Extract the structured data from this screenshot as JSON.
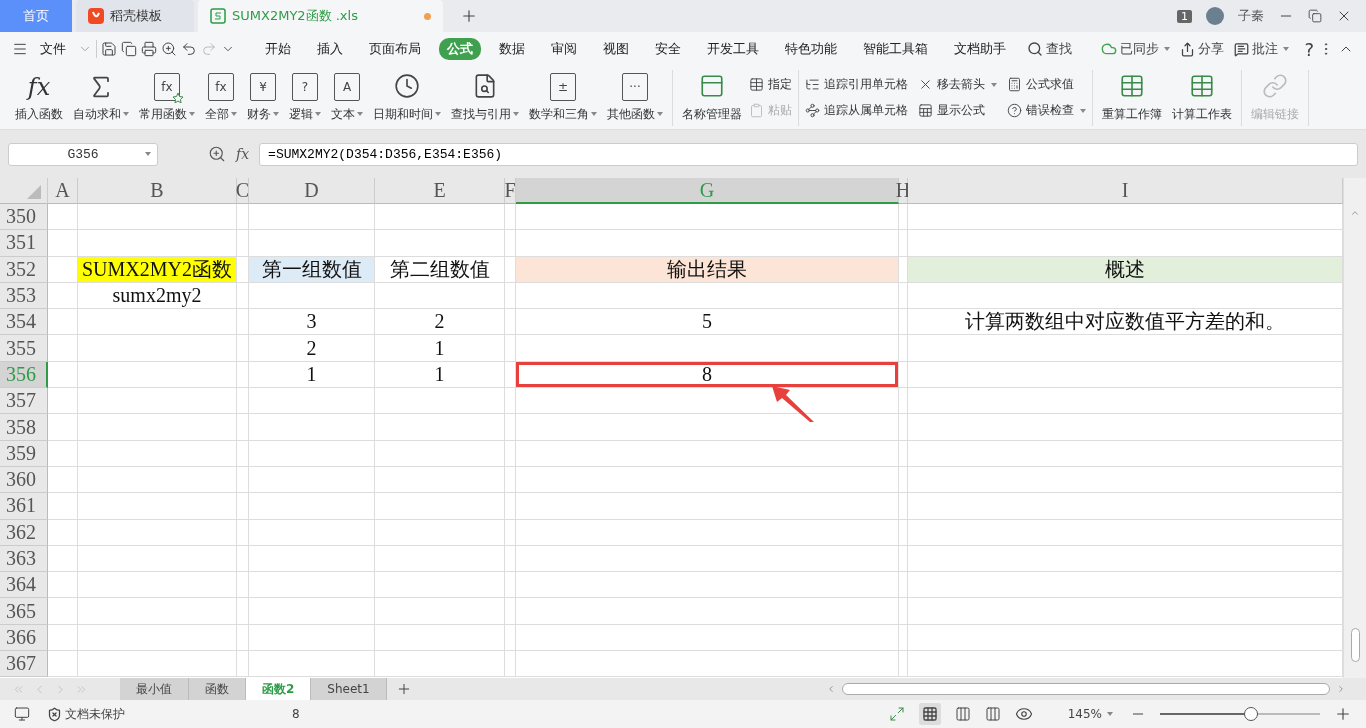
{
  "tabs": [
    {
      "label": "首页",
      "kind": "home",
      "selected": false,
      "modified": false
    },
    {
      "label": "稻壳模板",
      "kind": "docer",
      "selected": false,
      "modified": false
    },
    {
      "label": "SUMX2MY2函数 .xls",
      "kind": "sheet",
      "selected": true,
      "modified": true
    }
  ],
  "window_badge": "1",
  "user": "子秦",
  "menu": {
    "file": "文件",
    "tabs": [
      {
        "label": "开始",
        "selected": false
      },
      {
        "label": "插入",
        "selected": false
      },
      {
        "label": "页面布局",
        "selected": false
      },
      {
        "label": "公式",
        "selected": true
      },
      {
        "label": "数据",
        "selected": false
      },
      {
        "label": "审阅",
        "selected": false
      },
      {
        "label": "视图",
        "selected": false
      },
      {
        "label": "安全",
        "selected": false
      },
      {
        "label": "开发工具",
        "selected": false
      },
      {
        "label": "特色功能",
        "selected": false
      },
      {
        "label": "智能工具箱",
        "selected": false
      },
      {
        "label": "文档助手",
        "selected": false
      }
    ],
    "search": "查找",
    "sync": "已同步",
    "share": "分享",
    "comment": "批注",
    "help": "?"
  },
  "ribbon": [
    {
      "items": [
        {
          "kind": "fx",
          "icon_text": "fx",
          "label": "插入函数",
          "dropdown": false,
          "disabled": false
        },
        {
          "kind": "sigma",
          "label": "自动求和",
          "dropdown": true,
          "disabled": false
        },
        {
          "kind": "star",
          "icon_text": "fx",
          "label": "常用函数",
          "dropdown": true,
          "disabled": false
        },
        {
          "kind": "book",
          "icon_text": "fx",
          "label": "全部",
          "dropdown": true,
          "disabled": false
        },
        {
          "kind": "book",
          "icon_text": "¥",
          "label": "财务",
          "dropdown": true,
          "disabled": false
        },
        {
          "kind": "book",
          "icon_text": "?",
          "label": "逻辑",
          "dropdown": true,
          "disabled": false
        },
        {
          "kind": "book",
          "icon_text": "A",
          "label": "文本",
          "dropdown": true,
          "disabled": false
        },
        {
          "kind": "clock",
          "label": "日期和时间",
          "dropdown": true,
          "disabled": false
        },
        {
          "kind": "lookup",
          "label": "查找与引用",
          "dropdown": true,
          "disabled": false
        },
        {
          "kind": "book",
          "icon_text": "±",
          "label": "数学和三角",
          "dropdown": true,
          "disabled": false
        },
        {
          "kind": "book",
          "icon_text": "···",
          "label": "其他函数",
          "dropdown": true,
          "disabled": false
        }
      ]
    },
    {
      "items": [
        {
          "kind": "names",
          "label": "名称管理器",
          "dropdown": false,
          "disabled": false
        },
        {
          "kind": "small",
          "label": "指定",
          "dropdown": false,
          "disabled": false
        },
        {
          "kind": "small",
          "label": "粘贴",
          "dropdown": false,
          "disabled": true
        }
      ]
    },
    {
      "items": [
        {
          "kind": "small",
          "label": "追踪引用单元格",
          "dropdown": false,
          "disabled": false
        },
        {
          "kind": "small",
          "label": "追踪从属单元格",
          "dropdown": false,
          "disabled": false
        },
        {
          "kind": "small",
          "label": "移去箭头",
          "dropdown": true,
          "disabled": false
        },
        {
          "kind": "small",
          "label": "显示公式",
          "dropdown": false,
          "disabled": false
        },
        {
          "kind": "small",
          "label": "公式求值",
          "dropdown": false,
          "disabled": false
        },
        {
          "kind": "small",
          "label": "错误检查",
          "dropdown": true,
          "disabled": false
        }
      ]
    },
    {
      "items": [
        {
          "kind": "calc",
          "label": "重算工作簿",
          "dropdown": false,
          "disabled": false
        },
        {
          "kind": "calc",
          "label": "计算工作表",
          "dropdown": false,
          "disabled": false
        }
      ]
    },
    {
      "items": [
        {
          "kind": "link",
          "label": "编辑链接",
          "dropdown": false,
          "disabled": true
        }
      ]
    }
  ],
  "name_box": "G356",
  "fx": "fx",
  "formula": "=SUMX2MY2(D354:D356,E354:E356)",
  "columns": [
    {
      "label": "A",
      "selected": false
    },
    {
      "label": "B",
      "selected": false
    },
    {
      "label": "C",
      "selected": false
    },
    {
      "label": "D",
      "selected": false
    },
    {
      "label": "E",
      "selected": false
    },
    {
      "label": "F",
      "selected": false
    },
    {
      "label": "G",
      "selected": true
    },
    {
      "label": "H",
      "selected": false
    },
    {
      "label": "I",
      "selected": false
    }
  ],
  "rows": [
    {
      "number": "350",
      "selected": false
    },
    {
      "number": "351",
      "selected": false
    },
    {
      "number": "352",
      "selected": false,
      "b": {
        "text": "SUMX2MY2函数",
        "color": "#ffff00"
      },
      "d": {
        "text": "第一组数值",
        "color": "#ddebf7"
      },
      "e": {
        "text": "第二组数值"
      },
      "g": {
        "text": "输出结果",
        "color": "#fce4d6"
      },
      "i": {
        "text": "概述",
        "color": "#e2efda"
      }
    },
    {
      "number": "353",
      "selected": false,
      "b": {
        "text": "sumx2my2"
      }
    },
    {
      "number": "354",
      "selected": false,
      "d": {
        "text": "3"
      },
      "e": {
        "text": "2"
      },
      "g": {
        "text": "5"
      },
      "i": {
        "text": "计算两数组中对应数值平方差的和。"
      }
    },
    {
      "number": "355",
      "selected": false,
      "d": {
        "text": "2"
      },
      "e": {
        "text": "1"
      }
    },
    {
      "number": "356",
      "selected": true,
      "d": {
        "text": "1"
      },
      "e": {
        "text": "1"
      },
      "g": {
        "text": "8"
      }
    },
    {
      "number": "357",
      "selected": false
    },
    {
      "number": "358",
      "selected": false
    },
    {
      "number": "359",
      "selected": false
    },
    {
      "number": "360",
      "selected": false
    },
    {
      "number": "361",
      "selected": false
    },
    {
      "number": "362",
      "selected": false
    },
    {
      "number": "363",
      "selected": false
    },
    {
      "number": "364",
      "selected": false
    },
    {
      "number": "365",
      "selected": false
    },
    {
      "number": "366",
      "selected": false
    },
    {
      "number": "367",
      "selected": false
    }
  ],
  "annotation": {
    "box": true,
    "arrow": true
  },
  "sheet_tabs": [
    {
      "label": "最小值",
      "selected": false
    },
    {
      "label": "函数",
      "selected": false
    },
    {
      "label": "函数2",
      "selected": true
    },
    {
      "label": "Sheet1",
      "selected": false
    }
  ],
  "status": {
    "protection": "文档未保护",
    "sum": "8",
    "zoom": "145%",
    "zoom_slider": {
      "level": 0.57
    }
  }
}
